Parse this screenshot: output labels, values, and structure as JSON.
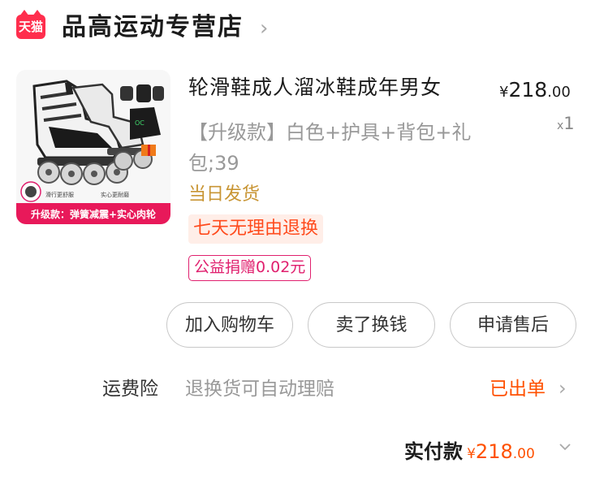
{
  "shop": {
    "badge": "天猫",
    "name": "品高运动专营店"
  },
  "product": {
    "title": "轮滑鞋成人溜冰鞋成年男女",
    "price_symbol": "¥",
    "price_int": "218",
    "price_dec": ".00",
    "qty_prefix": "x",
    "qty": "1",
    "sku": "【升级款】白色+护具+背包+礼包;39",
    "ship_tag": "当日发货",
    "return_tag": "七天无理由退换",
    "charity_tag": "公益捐赠0.02元",
    "image": {
      "banner_text": "升级款：弹簧减震+实心肉轮",
      "caption_left": "滑行更舒服",
      "caption_right": "实心更耐磨",
      "bag_logo": "OC"
    }
  },
  "actions": {
    "add_to_cart": "加入购物车",
    "sell": "卖了换钱",
    "after_sale": "申请售后"
  },
  "insurance": {
    "label": "运费险",
    "desc": "退换货可自动理赔",
    "status": "已出单"
  },
  "total": {
    "label": "实付款",
    "symbol": "¥",
    "int": "218",
    "dec": ".00"
  },
  "colors": {
    "accent": "#ff5000",
    "tmall_red": "#ff2e4d",
    "charity": "#e0206e",
    "ship_gold": "#c89534"
  }
}
